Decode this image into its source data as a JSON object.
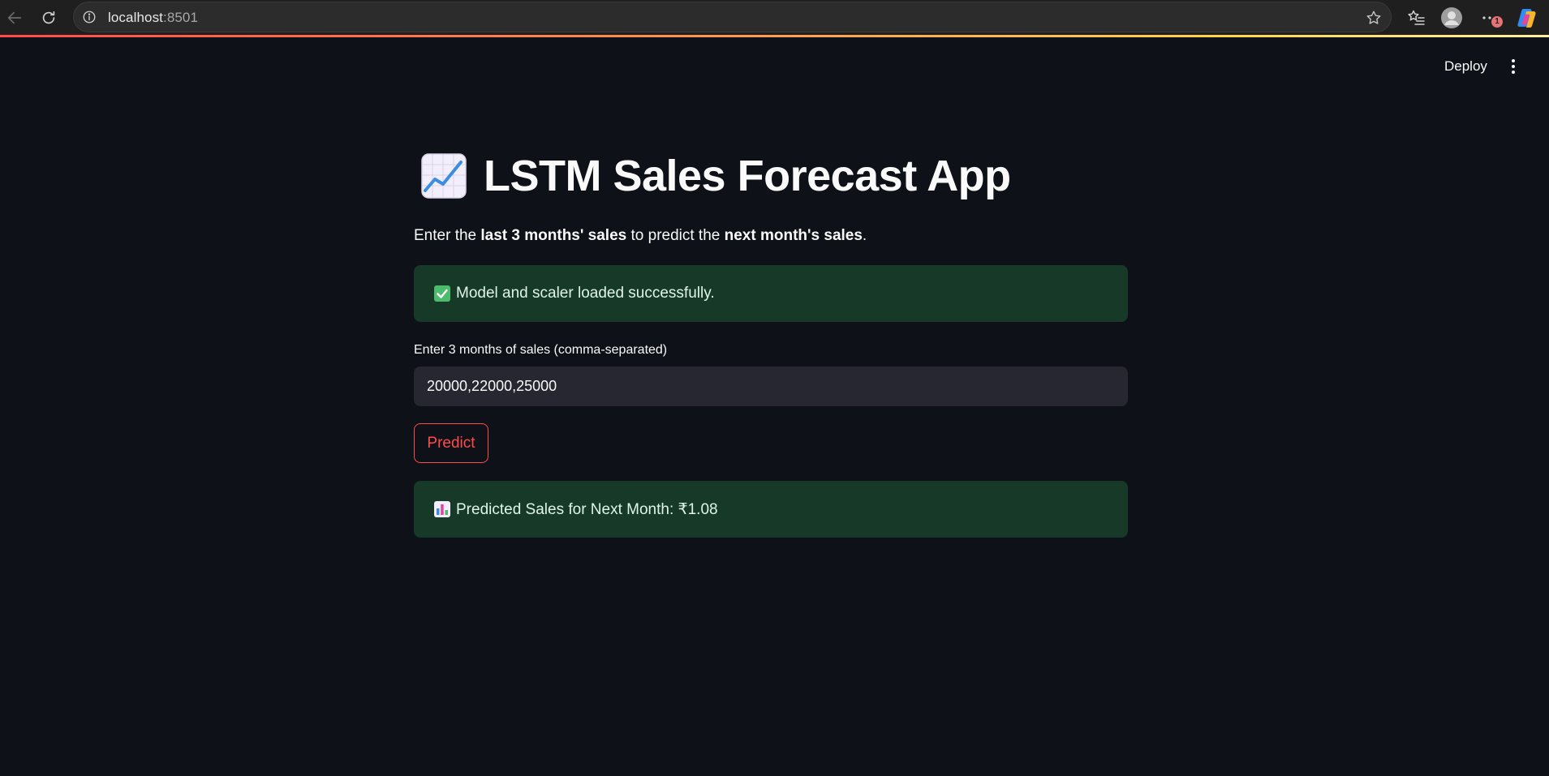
{
  "browser": {
    "url_host": "localhost",
    "url_port": ":8501",
    "notification_count": "1"
  },
  "header": {
    "deploy_label": "Deploy"
  },
  "main": {
    "title_icon": "chart-increasing-icon",
    "title": "LSTM Sales Forecast App",
    "subtitle": {
      "part1": "Enter the ",
      "bold1": "last 3 months' sales",
      "part2": " to predict the ",
      "bold2": "next month's sales",
      "part3": "."
    },
    "success_message": "Model and scaler loaded successfully.",
    "input_label": "Enter 3 months of sales (comma-separated)",
    "input_value": "20000,22000,25000",
    "predict_label": "Predict",
    "result_message": "Predicted Sales for Next Month: ₹1.08"
  },
  "colors": {
    "background": "#0e1117",
    "accent": "#ff4b4b",
    "success_bg": "#173928",
    "input_bg": "#262730"
  }
}
